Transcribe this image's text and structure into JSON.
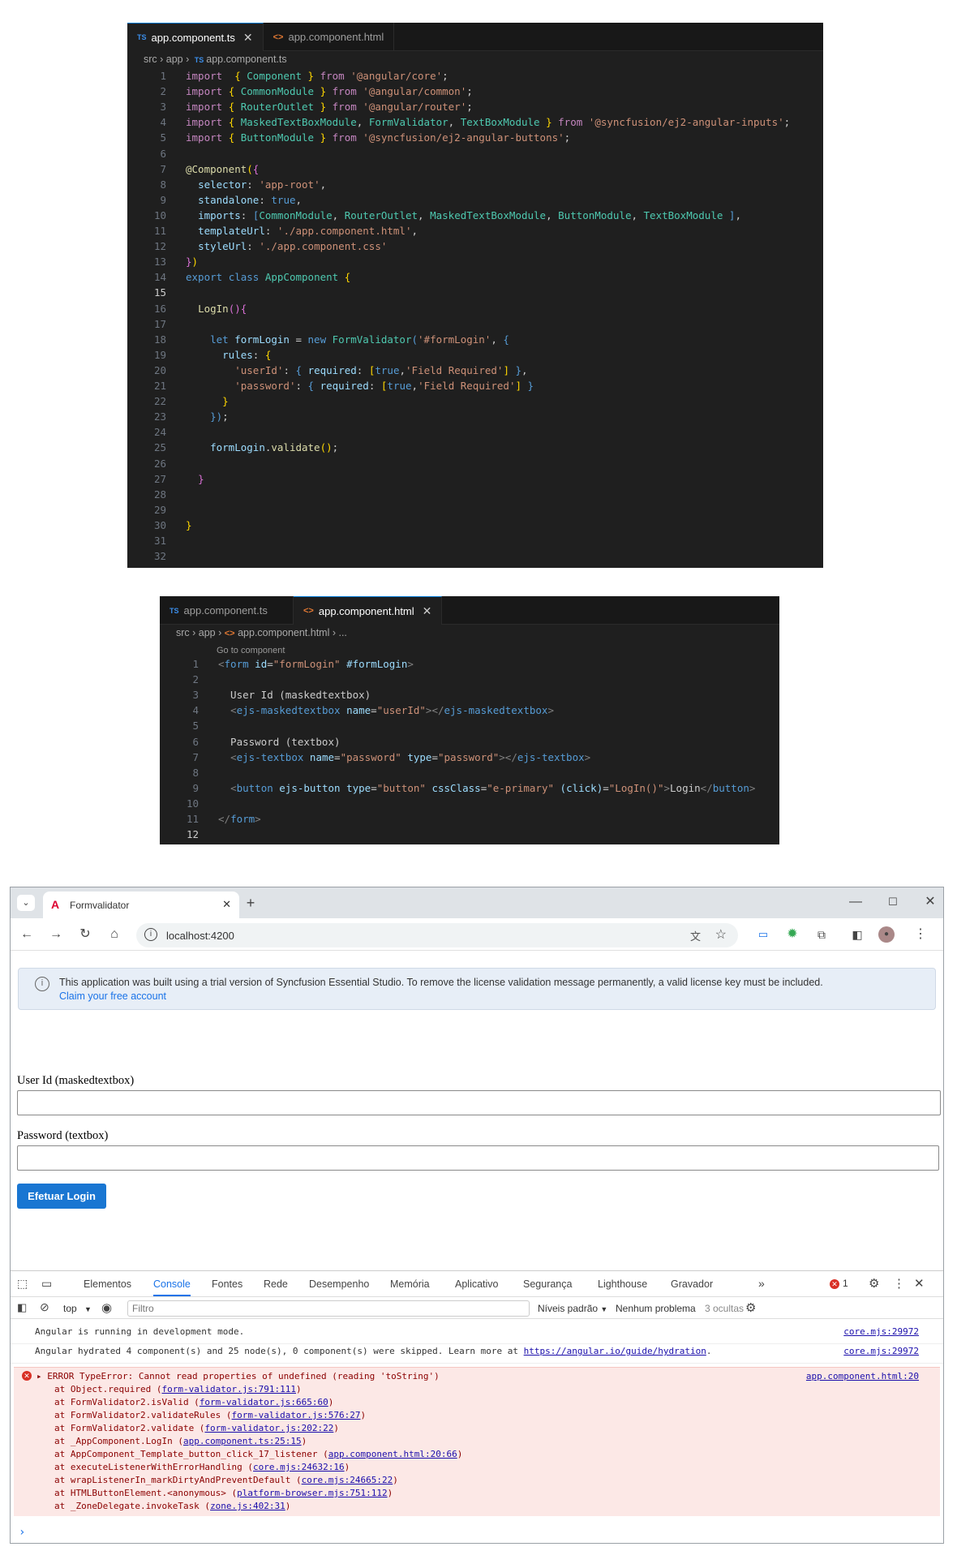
{
  "editor1": {
    "tabs": [
      {
        "label": "app.component.ts",
        "active": true,
        "kind": "ts"
      },
      {
        "label": "app.component.html",
        "active": false,
        "kind": "html"
      }
    ],
    "breadcrumb": [
      "src",
      "app",
      "app.component.ts"
    ],
    "current_line": 15,
    "lines": [
      [
        [
          "k",
          "import"
        ],
        [
          "",
          "  "
        ],
        [
          "y",
          "{"
        ],
        [
          "",
          " "
        ],
        [
          "t",
          "Component"
        ],
        [
          "",
          " "
        ],
        [
          "y",
          "}"
        ],
        [
          "",
          " "
        ],
        [
          "k",
          "from"
        ],
        [
          "",
          " "
        ],
        [
          "s",
          "'@angular/core'"
        ],
        [
          "",
          ";"
        ]
      ],
      [
        [
          "k",
          "import"
        ],
        [
          "",
          " "
        ],
        [
          "y",
          "{"
        ],
        [
          "",
          " "
        ],
        [
          "t",
          "CommonModule"
        ],
        [
          "",
          " "
        ],
        [
          "y",
          "}"
        ],
        [
          "",
          " "
        ],
        [
          "k",
          "from"
        ],
        [
          "",
          " "
        ],
        [
          "s",
          "'@angular/common'"
        ],
        [
          "",
          ";"
        ]
      ],
      [
        [
          "k",
          "import"
        ],
        [
          "",
          " "
        ],
        [
          "y",
          "{"
        ],
        [
          "",
          " "
        ],
        [
          "t",
          "RouterOutlet"
        ],
        [
          "",
          " "
        ],
        [
          "y",
          "}"
        ],
        [
          "",
          " "
        ],
        [
          "k",
          "from"
        ],
        [
          "",
          " "
        ],
        [
          "s",
          "'@angular/router'"
        ],
        [
          "",
          ";"
        ]
      ],
      [
        [
          "k",
          "import"
        ],
        [
          "",
          " "
        ],
        [
          "y",
          "{"
        ],
        [
          "",
          " "
        ],
        [
          "t",
          "MaskedTextBoxModule"
        ],
        [
          "",
          ", "
        ],
        [
          "t",
          "FormValidator"
        ],
        [
          "",
          ", "
        ],
        [
          "t",
          "TextBoxModule"
        ],
        [
          "",
          " "
        ],
        [
          "y",
          "}"
        ],
        [
          "",
          " "
        ],
        [
          "k",
          "from"
        ],
        [
          "",
          " "
        ],
        [
          "s",
          "'@syncfusion/ej2-angular-inputs'"
        ],
        [
          "",
          ";"
        ]
      ],
      [
        [
          "k",
          "import"
        ],
        [
          "",
          " "
        ],
        [
          "y",
          "{"
        ],
        [
          "",
          " "
        ],
        [
          "t",
          "ButtonModule"
        ],
        [
          "",
          " "
        ],
        [
          "y",
          "}"
        ],
        [
          "",
          " "
        ],
        [
          "k",
          "from"
        ],
        [
          "",
          " "
        ],
        [
          "s",
          "'@syncfusion/ej2-angular-buttons'"
        ],
        [
          "",
          ";"
        ]
      ],
      [],
      [
        [
          "f",
          "@Component"
        ],
        [
          "y",
          "("
        ],
        [
          "p",
          "{"
        ]
      ],
      [
        [
          "",
          "  "
        ],
        [
          "v",
          "selector"
        ],
        [
          "",
          ": "
        ],
        [
          "s",
          "'app-root'"
        ],
        [
          "",
          ","
        ]
      ],
      [
        [
          "",
          "  "
        ],
        [
          "v",
          "standalone"
        ],
        [
          "",
          ": "
        ],
        [
          "b",
          "true"
        ],
        [
          "",
          ","
        ]
      ],
      [
        [
          "",
          "  "
        ],
        [
          "v",
          "imports"
        ],
        [
          "",
          ": "
        ],
        [
          "b",
          "["
        ],
        [
          "t",
          "CommonModule"
        ],
        [
          "",
          ", "
        ],
        [
          "t",
          "RouterOutlet"
        ],
        [
          "",
          ", "
        ],
        [
          "t",
          "MaskedTextBoxModule"
        ],
        [
          "",
          ", "
        ],
        [
          "t",
          "ButtonModule"
        ],
        [
          "",
          ", "
        ],
        [
          "t",
          "TextBoxModule"
        ],
        [
          "",
          " "
        ],
        [
          "b",
          "]"
        ],
        [
          "",
          ","
        ]
      ],
      [
        [
          "",
          "  "
        ],
        [
          "v",
          "templateUrl"
        ],
        [
          "",
          ": "
        ],
        [
          "s",
          "'./app.component.html'"
        ],
        [
          "",
          ","
        ]
      ],
      [
        [
          "",
          "  "
        ],
        [
          "v",
          "styleUrl"
        ],
        [
          "",
          ": "
        ],
        [
          "s",
          "'./app.component.css'"
        ]
      ],
      [
        [
          "p",
          "}"
        ],
        [
          "y",
          ")"
        ]
      ],
      [
        [
          "b",
          "export"
        ],
        [
          "",
          " "
        ],
        [
          "b",
          "class"
        ],
        [
          "",
          " "
        ],
        [
          "t",
          "AppComponent"
        ],
        [
          "",
          " "
        ],
        [
          "y",
          "{"
        ]
      ],
      [],
      [
        [
          "",
          "  "
        ],
        [
          "f",
          "LogIn"
        ],
        [
          "p",
          "()"
        ],
        [
          "p",
          "{"
        ]
      ],
      [],
      [
        [
          "",
          "    "
        ],
        [
          "b",
          "let"
        ],
        [
          "",
          " "
        ],
        [
          "v",
          "formLogin"
        ],
        [
          "",
          " = "
        ],
        [
          "b",
          "new"
        ],
        [
          "",
          " "
        ],
        [
          "t",
          "FormValidator"
        ],
        [
          "b",
          "("
        ],
        [
          "s",
          "'#formLogin'"
        ],
        [
          "",
          ", "
        ],
        [
          "b",
          "{"
        ]
      ],
      [
        [
          "",
          "      "
        ],
        [
          "v",
          "rules"
        ],
        [
          "",
          ": "
        ],
        [
          "y",
          "{"
        ]
      ],
      [
        [
          "",
          "        "
        ],
        [
          "s",
          "'userId'"
        ],
        [
          "",
          ": "
        ],
        [
          "b",
          "{"
        ],
        [
          "",
          " "
        ],
        [
          "v",
          "required"
        ],
        [
          "",
          ": "
        ],
        [
          "y",
          "["
        ],
        [
          "b",
          "true"
        ],
        [
          "",
          ","
        ],
        [
          "s",
          "'Field Required'"
        ],
        [
          "y",
          "]"
        ],
        [
          "",
          " "
        ],
        [
          "b",
          "}"
        ],
        [
          "",
          ","
        ]
      ],
      [
        [
          "",
          "        "
        ],
        [
          "s",
          "'password'"
        ],
        [
          "",
          ": "
        ],
        [
          "b",
          "{"
        ],
        [
          "",
          " "
        ],
        [
          "v",
          "required"
        ],
        [
          "",
          ": "
        ],
        [
          "y",
          "["
        ],
        [
          "b",
          "true"
        ],
        [
          "",
          ","
        ],
        [
          "s",
          "'Field Required'"
        ],
        [
          "y",
          "]"
        ],
        [
          "",
          " "
        ],
        [
          "b",
          "}"
        ]
      ],
      [
        [
          "",
          "      "
        ],
        [
          "y",
          "}"
        ]
      ],
      [
        [
          "",
          "    "
        ],
        [
          "b",
          "}"
        ],
        [
          "b",
          ")"
        ],
        [
          "",
          ";"
        ]
      ],
      [],
      [
        [
          "",
          "    "
        ],
        [
          "v",
          "formLogin"
        ],
        [
          "",
          "."
        ],
        [
          "f",
          "validate"
        ],
        [
          "y",
          "()"
        ],
        [
          "",
          ";"
        ]
      ],
      [],
      [
        [
          "",
          "  "
        ],
        [
          "p",
          "}"
        ]
      ],
      [],
      [],
      [
        [
          "y",
          "}"
        ]
      ],
      [],
      []
    ]
  },
  "editor2": {
    "tabs": [
      {
        "label": "app.component.ts",
        "active": false,
        "kind": "ts"
      },
      {
        "label": "app.component.html",
        "active": true,
        "kind": "html"
      }
    ],
    "breadcrumb": [
      "src",
      "app",
      "app.component.html",
      "..."
    ],
    "codelens": "Go to component",
    "current_line": 12,
    "lines": [
      [
        [
          "g",
          "<"
        ],
        [
          "b",
          "form"
        ],
        [
          "",
          " "
        ],
        [
          "a",
          "id"
        ],
        [
          "",
          "="
        ],
        [
          "s",
          "\"formLogin\""
        ],
        [
          "",
          " "
        ],
        [
          "a",
          "#formLogin"
        ],
        [
          "g",
          ">"
        ]
      ],
      [],
      [
        [
          "",
          "  User Id (maskedtextbox)"
        ]
      ],
      [
        [
          "",
          "  "
        ],
        [
          "g",
          "<"
        ],
        [
          "b",
          "ejs-maskedtextbox"
        ],
        [
          "",
          " "
        ],
        [
          "a",
          "name"
        ],
        [
          "",
          "="
        ],
        [
          "s",
          "\"userId\""
        ],
        [
          "g",
          "></"
        ],
        [
          "b",
          "ejs-maskedtextbox"
        ],
        [
          "g",
          ">"
        ]
      ],
      [],
      [
        [
          "",
          "  Password (textbox)"
        ]
      ],
      [
        [
          "",
          "  "
        ],
        [
          "g",
          "<"
        ],
        [
          "b",
          "ejs-textbox"
        ],
        [
          "",
          " "
        ],
        [
          "a",
          "name"
        ],
        [
          "",
          "="
        ],
        [
          "s",
          "\"password\""
        ],
        [
          "",
          " "
        ],
        [
          "a",
          "type"
        ],
        [
          "",
          "="
        ],
        [
          "s",
          "\"password\""
        ],
        [
          "g",
          "></"
        ],
        [
          "b",
          "ejs-textbox"
        ],
        [
          "g",
          ">"
        ]
      ],
      [],
      [
        [
          "",
          "  "
        ],
        [
          "g",
          "<"
        ],
        [
          "b",
          "button"
        ],
        [
          "",
          " "
        ],
        [
          "a",
          "ejs-button"
        ],
        [
          "",
          " "
        ],
        [
          "a",
          "type"
        ],
        [
          "",
          "="
        ],
        [
          "s",
          "\"button\""
        ],
        [
          "",
          " "
        ],
        [
          "a",
          "cssClass"
        ],
        [
          "",
          "="
        ],
        [
          "s",
          "\"e-primary\""
        ],
        [
          "",
          " "
        ],
        [
          "a",
          "(click)"
        ],
        [
          "",
          "="
        ],
        [
          "s",
          "\"LogIn()\""
        ],
        [
          "g",
          ">"
        ],
        [
          "",
          "Login"
        ],
        [
          "g",
          "</"
        ],
        [
          "b",
          "button"
        ],
        [
          "g",
          ">"
        ]
      ],
      [],
      [
        [
          "g",
          "</"
        ],
        [
          "b",
          "form"
        ],
        [
          "g",
          ">"
        ]
      ],
      []
    ]
  },
  "browser": {
    "tab_title": "Formvalidator",
    "url": "localhost:4200",
    "banner_text": "This application was built using a trial version of Syncfusion Essential Studio. To remove the license validation message permanently, a valid license key must be included.",
    "banner_link": "Claim your free account",
    "userid_label": "User Id (maskedtextbox)",
    "password_label": "Password (textbox)",
    "login_button": "Efetuar Login"
  },
  "devtools": {
    "tabs": [
      "Elementos",
      "Console",
      "Fontes",
      "Rede",
      "Desempenho",
      "Memória",
      "Aplicativo",
      "Segurança",
      "Lighthouse",
      "Gravador"
    ],
    "active_tab": "Console",
    "error_count": "1",
    "context": "top",
    "filter_placeholder": "Filtro",
    "levels": "Níveis padrão",
    "issues": "Nenhum problema",
    "hidden": "3 ocultas",
    "messages": [
      {
        "text": "Angular is running in development mode.",
        "source": "core.mjs:29972"
      },
      {
        "text": "Angular hydrated 4 component(s) and 25 node(s), 0 component(s) were skipped. Learn more at ",
        "link": "https://angular.io/guide/hydration",
        "suffix": ".",
        "source": "core.mjs:29972"
      }
    ],
    "error": {
      "head": "ERROR TypeError: Cannot read properties of undefined (reading 'toString')",
      "source": "app.component.html:20",
      "stack": [
        [
          "at Object.required (",
          "form-validator.js:791:111",
          ")"
        ],
        [
          "at FormValidator2.isValid (",
          "form-validator.js:665:60",
          ")"
        ],
        [
          "at FormValidator2.validateRules (",
          "form-validator.js:576:27",
          ")"
        ],
        [
          "at FormValidator2.validate (",
          "form-validator.js:202:22",
          ")"
        ],
        [
          "at _AppComponent.LogIn (",
          "app.component.ts:25:15",
          ")"
        ],
        [
          "at AppComponent_Template_button_click_17_listener (",
          "app.component.html:20:66",
          ")"
        ],
        [
          "at executeListenerWithErrorHandling (",
          "core.mjs:24632:16",
          ")"
        ],
        [
          "at wrapListenerIn_markDirtyAndPreventDefault (",
          "core.mjs:24665:22",
          ")"
        ],
        [
          "at HTMLButtonElement.<anonymous> (",
          "platform-browser.mjs:751:112",
          ")"
        ],
        [
          "at _ZoneDelegate.invokeTask (",
          "zone.js:402:31",
          ")"
        ]
      ]
    },
    "prompt": "›"
  }
}
